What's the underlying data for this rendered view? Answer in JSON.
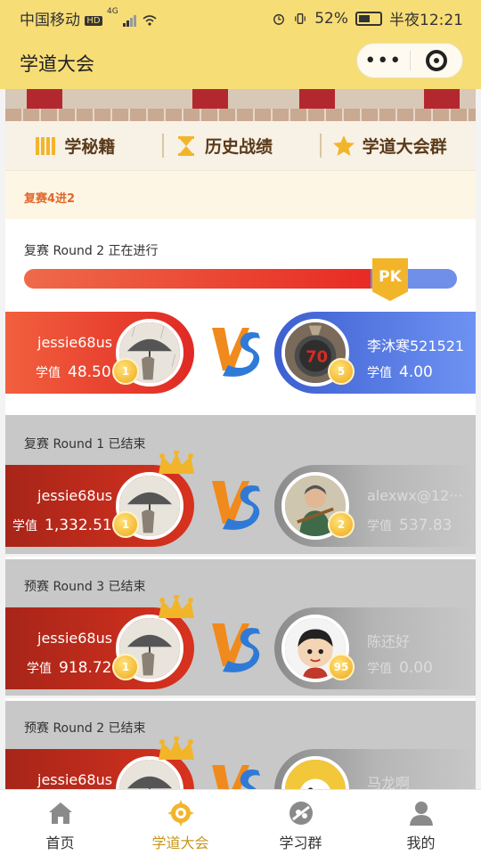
{
  "status_bar": {
    "carrier": "中国移动",
    "hd_badge": "HD",
    "net": "4G",
    "battery": "52%",
    "time": "半夜12:21"
  },
  "header": {
    "title": "学道大会",
    "more_label": "•••"
  },
  "tabs": [
    {
      "label": "学秘籍",
      "icon": "book-icon"
    },
    {
      "label": "历史战绩",
      "icon": "hourglass-icon"
    },
    {
      "label": "学道大会群",
      "icon": "star-icon"
    }
  ],
  "stage_label": "复赛4进2",
  "pk_badge": "PK",
  "vs_label": "VS",
  "score_label": "学值",
  "rounds": [
    {
      "title": "复赛 Round 2 正在进行",
      "left": {
        "name": "jessie68us",
        "score": "48.50",
        "level": "1"
      },
      "right": {
        "name": "李沐寒521521",
        "score": "4.00",
        "level": "5"
      }
    },
    {
      "title": "复赛 Round 1 已结束",
      "left": {
        "name": "jessie68us",
        "score": "1,332.51",
        "level": "1"
      },
      "right": {
        "name": "alexwx@12···",
        "score": "537.83",
        "level": "2"
      }
    },
    {
      "title": "预赛 Round 3 已结束",
      "left": {
        "name": "jessie68us",
        "score": "918.72",
        "level": "1"
      },
      "right": {
        "name": "陈还好",
        "score": "0.00",
        "level": "95"
      }
    },
    {
      "title": "预赛 Round 2 已结束",
      "left": {
        "name": "jessie68us",
        "score": "",
        "level": ""
      },
      "right": {
        "name": "马龙啊",
        "score": "",
        "level": ""
      }
    }
  ],
  "nav": [
    {
      "label": "首页",
      "icon": "home-icon"
    },
    {
      "label": "学道大会",
      "icon": "contest-icon",
      "active": true
    },
    {
      "label": "学习群",
      "icon": "group-icon"
    },
    {
      "label": "我的",
      "icon": "profile-icon"
    }
  ],
  "colors": {
    "header_bg": "#f7dd76",
    "accent": "#e02a24",
    "opponent": "#4d70df",
    "gold": "#f2b52a"
  }
}
